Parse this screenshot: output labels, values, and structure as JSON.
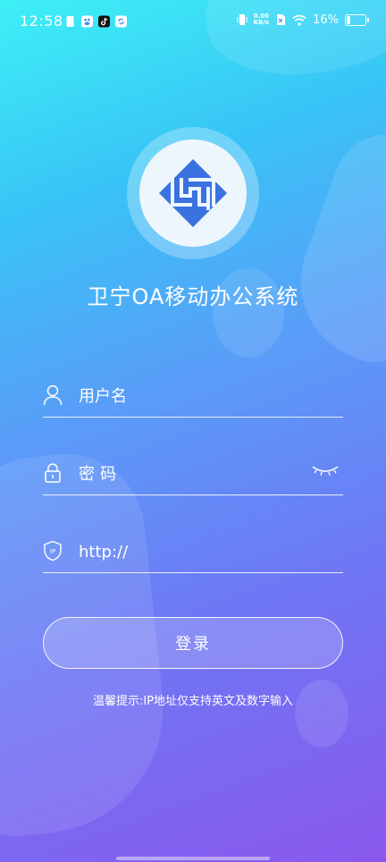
{
  "status_bar": {
    "time": "12:58",
    "net_speed_value": "0.00",
    "net_speed_unit": "KB/s",
    "battery_text": "16%",
    "battery_level": 0.16,
    "left_icons": [
      "sim-icon",
      "baidu-icon",
      "tiktok-icon",
      "sync-icon"
    ],
    "right_icons": [
      "vibrate-icon",
      "sim-status-icon",
      "wifi-icon",
      "battery-icon"
    ]
  },
  "app": {
    "title": "卫宁OA移动办公系统",
    "logo_color": "#3a72e0"
  },
  "form": {
    "username_placeholder": "用户名",
    "password_placeholder": "密码",
    "ip_value": "http://",
    "login_label": "登录",
    "hint": "温馨提示:IP地址仅支持英文及数字输入"
  }
}
